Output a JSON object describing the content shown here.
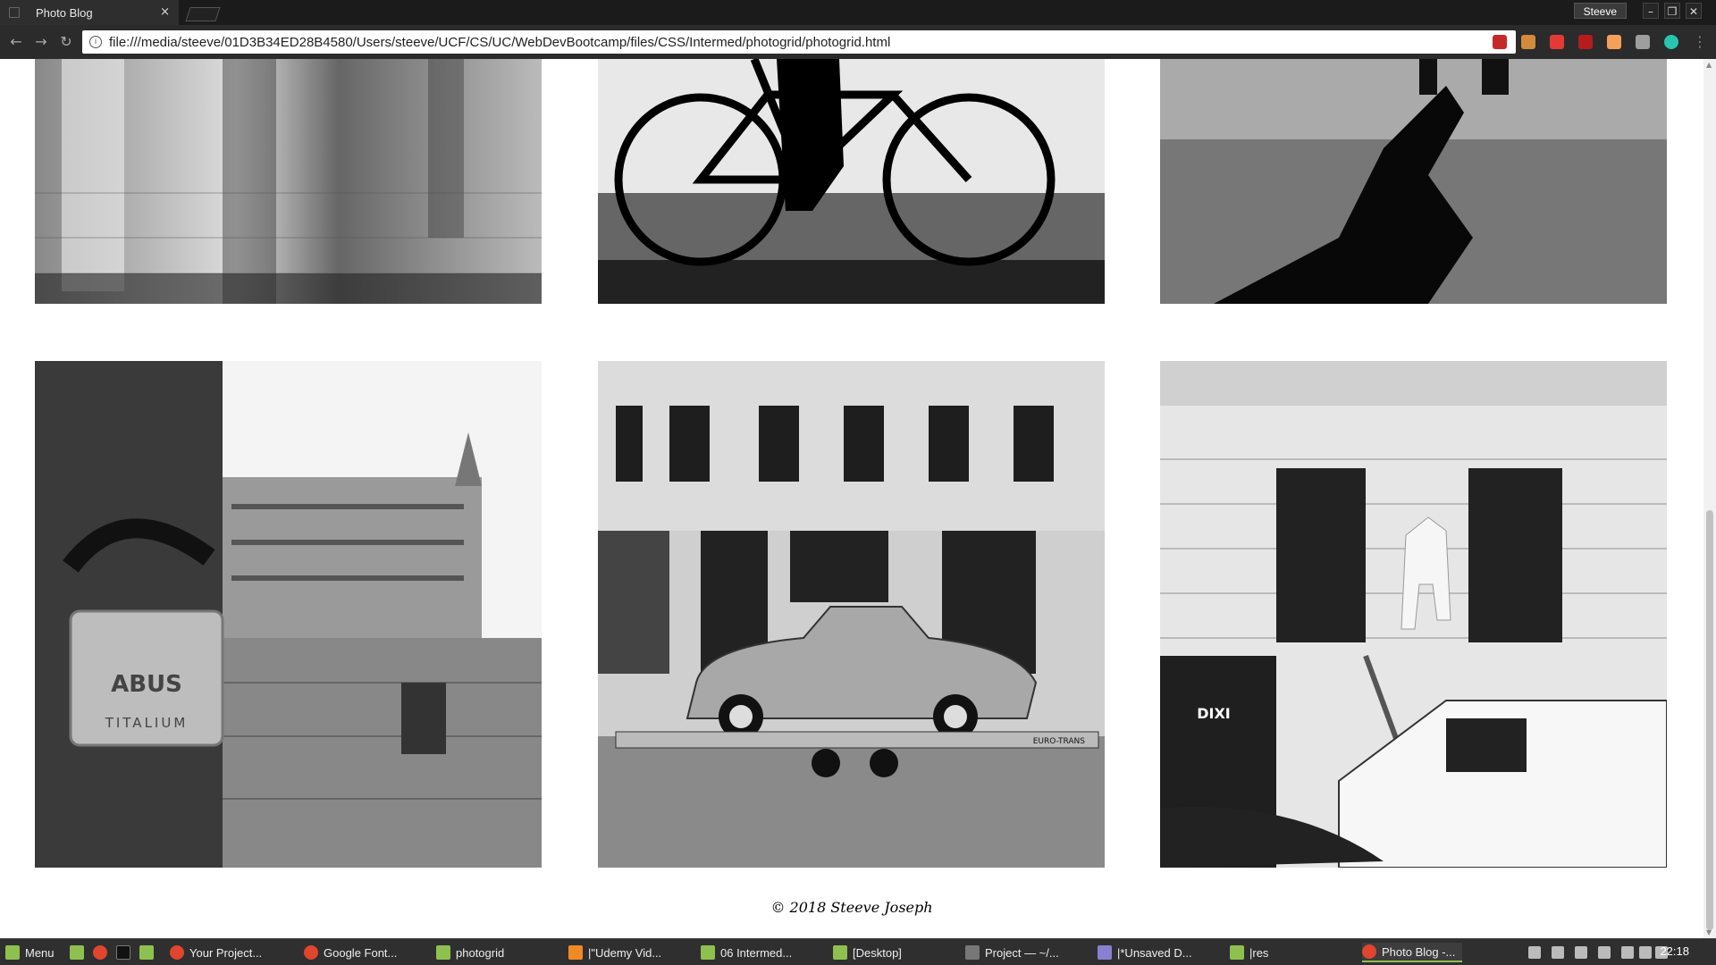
{
  "browser": {
    "tab_title": "Photo Blog",
    "tab_close": "×",
    "profile_name": "Steeve",
    "url": "file:///media/steeve/01D3B34ED28B4580/Users/steeve/UCF/CS/UC/WebDevBootcamp/files/CSS/Intermed/photogrid/photogrid.html",
    "info_icon": "i",
    "bookmark_icon": "☆"
  },
  "page": {
    "photos": [
      {
        "name": "photo-reflection",
        "desc": "Reflections on tiled floor"
      },
      {
        "name": "photo-bicycle",
        "desc": "Silhouette of cyclist"
      },
      {
        "name": "photo-shadow",
        "desc": "Shadow on cobblestone"
      },
      {
        "name": "photo-padlock",
        "desc": "ABUS padlock and town square"
      },
      {
        "name": "photo-car-trailer",
        "desc": "Vintage car on trailer"
      },
      {
        "name": "photo-painter",
        "desc": "Man on ladder and van"
      }
    ],
    "padlock_brand": "ABUS",
    "padlock_model": "TITALIUM",
    "toilet_brand": "DIXI",
    "trailer_text": "EURO-TRANS",
    "footer": "© 2018 Steeve Joseph"
  },
  "taskbar": {
    "menu_label": "Menu",
    "items": [
      {
        "label": "Your Project...",
        "color": "#e0452f"
      },
      {
        "label": "Google Font...",
        "color": "#e0452f"
      },
      {
        "label": "photogrid",
        "color": "#8ec04f"
      },
      {
        "label": "|\"Udemy Vid...",
        "color": "#f08a24"
      },
      {
        "label": "06 Intermed...",
        "color": "#8ec04f"
      },
      {
        "label": "[Desktop]",
        "color": "#8ec04f"
      },
      {
        "label": "Project — ~/...",
        "color": "#777"
      },
      {
        "label": "|*Unsaved D...",
        "color": "#8a7fd0"
      },
      {
        "label": "|res",
        "color": "#8ec04f"
      },
      {
        "label": "Photo Blog -...",
        "color": "#e0452f"
      }
    ],
    "clock": "22:18"
  }
}
